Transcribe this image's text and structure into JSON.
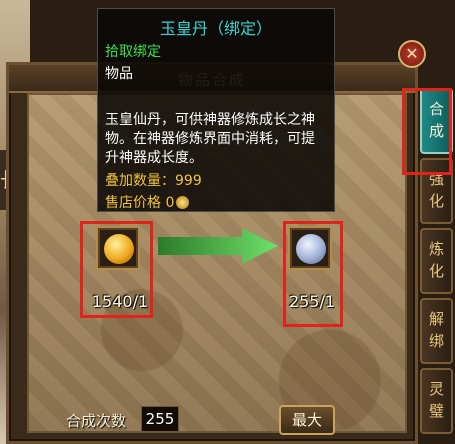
{
  "panel": {
    "title": "物品合成"
  },
  "tooltip": {
    "name": "玉皇丹（绑定）",
    "bind_note": "拾取绑定",
    "type": "物品",
    "description": "玉皇仙丹，可供神器修炼成长之神物。在神器修炼界面中消耗，可提升神器成长度。",
    "stack_label": "叠加数量：999",
    "price_label": "售店价格 0",
    "name_color": "#32d6d6",
    "bind_color": "#37e04b",
    "stat_color": "#f2c23a"
  },
  "tabs": [
    {
      "label": "合\n成",
      "active": true
    },
    {
      "label": "强\n化",
      "active": false
    },
    {
      "label": "炼\n化",
      "active": false
    },
    {
      "label": "解\n绑",
      "active": false
    },
    {
      "label": "灵\n璧",
      "active": false
    }
  ],
  "source_item": {
    "icon": "golden-elixir-icon",
    "count": "1540/1"
  },
  "target_item": {
    "icon": "blue-pill-icon",
    "count": "255/1"
  },
  "craft": {
    "count_label": "合成次数",
    "count_value": "255",
    "max_label": "最大"
  },
  "close_label": "✕",
  "world": {
    "sign_text": "长"
  },
  "colors": {
    "highlight": "#e3221b",
    "arrow": "#4fc04a",
    "active_tab": "#1f8a86"
  }
}
